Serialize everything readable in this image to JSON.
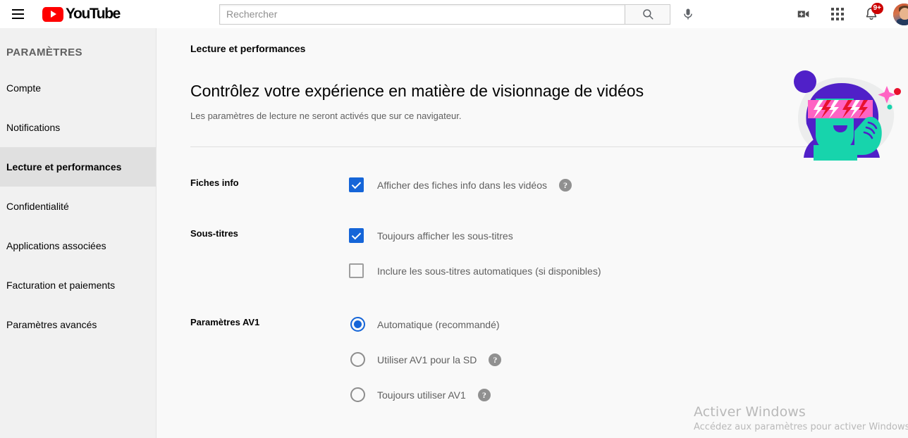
{
  "masthead": {
    "menu_icon": "hamburger-menu-icon",
    "logo_text": "YouTube",
    "search": {
      "placeholder": "Rechercher",
      "value": "",
      "search_icon": "search-icon",
      "mic_icon": "microphone-icon"
    },
    "create_icon": "video-camera-add-icon",
    "apps_icon": "apps-grid-icon",
    "notifications_icon": "bell-icon",
    "notifications_badge": "9+",
    "avatar_icon": "user-avatar"
  },
  "sidebar": {
    "title": "PARAMÈTRES",
    "items": [
      {
        "label": "Compte",
        "active": false
      },
      {
        "label": "Notifications",
        "active": false
      },
      {
        "label": "Lecture et performances",
        "active": true
      },
      {
        "label": "Confidentialité",
        "active": false
      },
      {
        "label": "Applications associées",
        "active": false
      },
      {
        "label": "Facturation et paiements",
        "active": false
      },
      {
        "label": "Paramètres avancés",
        "active": false
      }
    ]
  },
  "main": {
    "page_label": "Lecture et performances",
    "hero": {
      "title": "Contrôlez votre expérience en matière de visionnage de vidéos",
      "subtitle": "Les paramètres de lecture ne seront activés que sur ce navigateur.",
      "illustration_icon": "person-with-sunglasses-illustration"
    },
    "sections": [
      {
        "label": "Fiches info",
        "options": [
          {
            "type": "checkbox",
            "label": "Afficher des fiches info dans les vidéos",
            "checked": true,
            "help": true
          }
        ]
      },
      {
        "label": "Sous-titres",
        "options": [
          {
            "type": "checkbox",
            "label": "Toujours afficher les sous-titres",
            "checked": true,
            "help": false
          },
          {
            "type": "checkbox",
            "label": "Inclure les sous-titres automatiques (si disponibles)",
            "checked": false,
            "help": false
          }
        ]
      },
      {
        "label": "Paramètres AV1",
        "options": [
          {
            "type": "radio",
            "label": "Automatique (recommandé)",
            "checked": true,
            "help": false
          },
          {
            "type": "radio",
            "label": "Utiliser AV1 pour la SD",
            "checked": false,
            "help": true
          },
          {
            "type": "radio",
            "label": "Toujours utiliser AV1",
            "checked": false,
            "help": true
          }
        ]
      }
    ]
  },
  "watermark": {
    "title": "Activer Windows",
    "subtitle": "Accédez aux paramètres pour activer Windows"
  },
  "colors": {
    "accent_blue": "#1565d8",
    "youtube_red": "#ff0000",
    "badge_red": "#cc0000",
    "sidebar_bg": "#f1f1f1",
    "sidebar_active_bg": "#e0e0e0",
    "content_bg": "#f9f9f9",
    "secondary_text": "#606060"
  },
  "help_glyph": "?"
}
